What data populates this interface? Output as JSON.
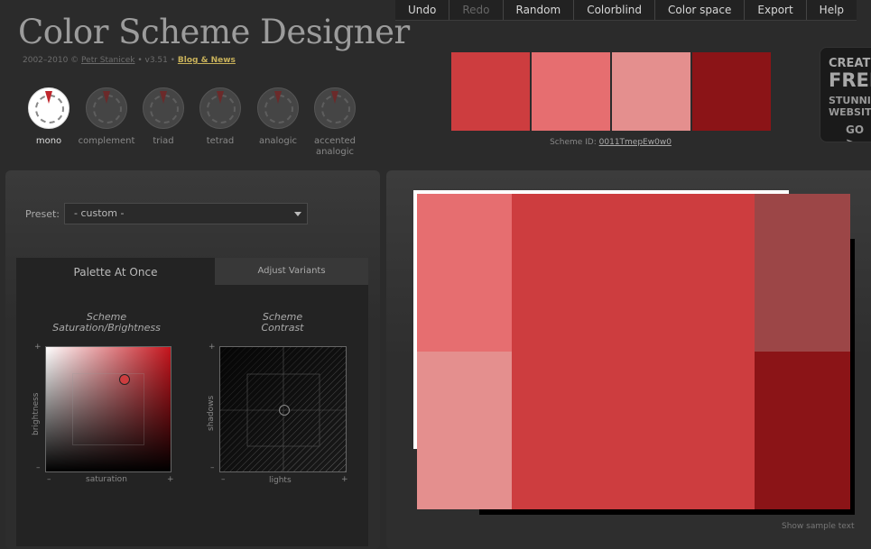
{
  "header": {
    "title": "Color Scheme Designer",
    "years": "2002–2010 ©",
    "author": "Petr Stanicek",
    "version": "• v3.51 •",
    "blog_link": "Blog & News"
  },
  "menu": [
    {
      "label": "Undo",
      "enabled": true
    },
    {
      "label": "Redo",
      "enabled": false
    },
    {
      "label": "Random",
      "enabled": true
    },
    {
      "label": "Colorblind",
      "enabled": true
    },
    {
      "label": "Color space",
      "enabled": true
    },
    {
      "label": "Export",
      "enabled": true
    },
    {
      "label": "Help",
      "enabled": true
    }
  ],
  "scheme_types": [
    {
      "label": "mono",
      "active": true
    },
    {
      "label": "complement",
      "active": false
    },
    {
      "label": "triad",
      "active": false
    },
    {
      "label": "tetrad",
      "active": false
    },
    {
      "label": "analogic",
      "active": false
    },
    {
      "label": "accented analogic",
      "active": false
    }
  ],
  "swatches": [
    "#cd3d3f",
    "#e66e70",
    "#e48f8e",
    "#8b1417"
  ],
  "scheme_id": {
    "label": "Scheme ID:",
    "value": "0011TmepEw0w0"
  },
  "ad": {
    "line1": "CREAT",
    "line2": "FREE",
    "line3": "STUNNIN",
    "line4": "WEBSITE",
    "line5": "GO >"
  },
  "preset": {
    "label": "Preset:",
    "value": "- custom -"
  },
  "tabs": {
    "palette": "Palette At Once",
    "adjust": "Adjust Variants"
  },
  "sb_panel": {
    "title_line1": "Scheme",
    "title_line2": "Saturation/Brightness",
    "x_label": "saturation",
    "y_label": "brightness",
    "minus": "–",
    "plus": "+",
    "saturation": 0.62,
    "brightness": 0.74
  },
  "contrast_panel": {
    "title_line1": "Scheme",
    "title_line2": "Contrast",
    "x_label": "lights",
    "y_label": "shadows",
    "minus": "–",
    "plus": "+",
    "lights": 0.5,
    "shadows": 0.5
  },
  "preview": {
    "colors": {
      "main": "#cd3d3f",
      "light": "#e66e70",
      "lighter": "#e48f8e",
      "dark_muted": "#9c4647",
      "dark": "#8b1417"
    },
    "show_sample": "Show sample text"
  }
}
